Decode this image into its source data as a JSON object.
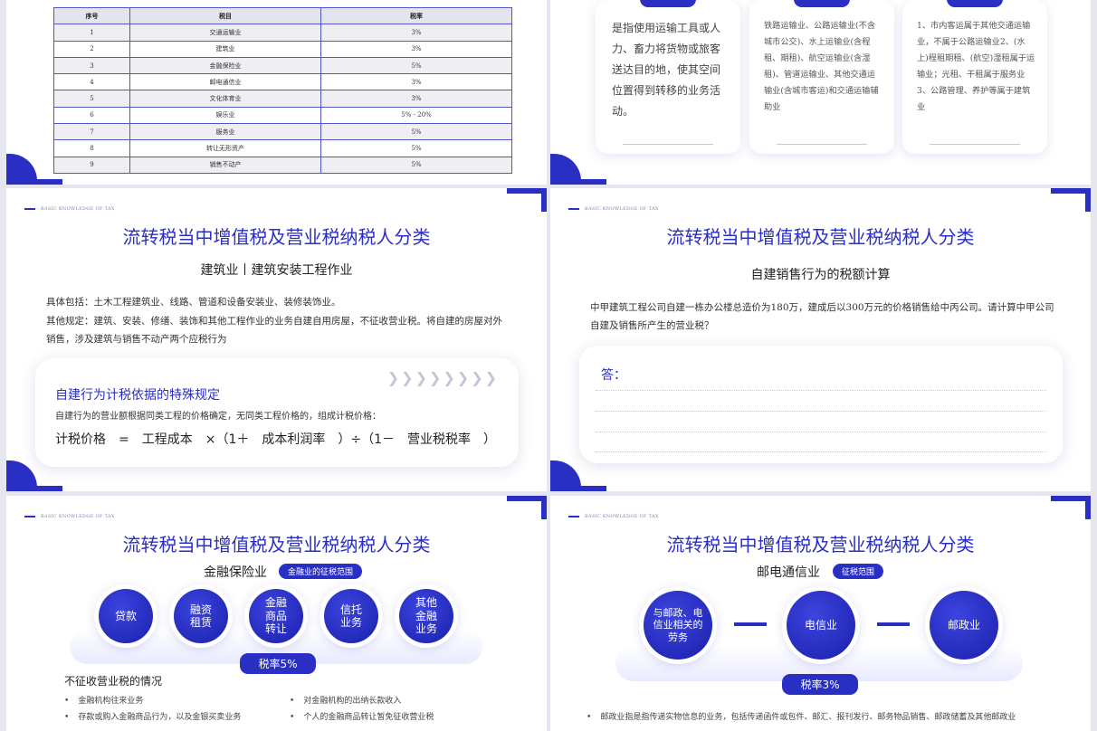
{
  "slide1": {
    "headers": [
      "序号",
      "税目",
      "税率"
    ],
    "rows": [
      [
        "1",
        "交通运输业",
        "3%"
      ],
      [
        "2",
        "建筑业",
        "3%"
      ],
      [
        "3",
        "金融保险业",
        "5%"
      ],
      [
        "4",
        "邮电通信业",
        "3%"
      ],
      [
        "5",
        "文化体育业",
        "3%"
      ],
      [
        "6",
        "娱乐业",
        "5% - 20%"
      ],
      [
        "7",
        "服务业",
        "5%"
      ],
      [
        "8",
        "转让无形资产",
        "5%"
      ],
      [
        "9",
        "销售不动产",
        "5%"
      ]
    ]
  },
  "slide2": {
    "card1": "是指使用运输工具或人力、畜力将货物或旅客送达目的地，使其空间位置得到转移的业务活动。",
    "card2": "铁路运输业、公路运输业(不含城市公交)、水上运输业(含程租、期租)、航空运输业(含湿租)、管道运输业、其他交通运输业(含城市客运)和交通运输辅助业",
    "card3": "1、市内客运属于其他交通运输业，不属于公路运输业2、(水上)程租期租、(航空)湿租属于运输业；光租、干租属于服务业\n3、公路管理、养护等属于建筑业"
  },
  "slide3": {
    "header": "BASIC KNOWLEDGE OF TAX",
    "title": "流转税当中增值税及营业税纳税人分类",
    "subtitle": "建筑业丨建筑安装工程作业",
    "p1": "具体包括：土木工程建筑业、线路、管道和设备安装业、装修装饰业。",
    "p2": "其他规定：建筑、安装、修缮、装饰和其他工程作业的业务自建自用房屋，不征收营业税。将自建的房屋对外销售，涉及建筑与销售不动产两个应税行为",
    "box_title": "自建行为计税依据的特殊规定",
    "box_text": "自建行为的营业额根据同类工程的价格确定，无同类工程价格的，组成计税价格：",
    "formula": "计税价格　=　工程成本　×（1＋　成本利润率　）÷（1－　营业税税率　）"
  },
  "slide4": {
    "header": "BASIC KNOWLEDGE OF TAX",
    "title": "流转税当中增值税及营业税纳税人分类",
    "subtitle": "自建销售行为的税额计算",
    "question": "中甲建筑工程公司自建一栋办公楼总造价为180万，建成后以300万元的价格销售给中丙公司。请计算中甲公司自建及销售所产生的营业税？",
    "answer_label": "答："
  },
  "slide5": {
    "header": "BASIC KNOWLEDGE OF TAX",
    "title": "流转税当中增值税及营业税纳税人分类",
    "subtitle": "金融保险业",
    "tag": "金融业的征税范围",
    "circles": [
      "贷款",
      "融资租赁",
      "金融商品转让",
      "信托业务",
      "其他金融业务"
    ],
    "rate": "税率5%",
    "no_tax_title": "不征收营业税的情况",
    "bullets_left": [
      "金融机构往来业务",
      "存款或购入金融商品行为，以及金银买卖业务"
    ],
    "bullets_right": [
      "对金融机构的出纳长款收入",
      "个人的金融商品转让暂免征收营业税"
    ]
  },
  "slide6": {
    "header": "BASIC KNOWLEDGE OF TAX",
    "title": "流转税当中增值税及营业税纳税人分类",
    "subtitle": "邮电通信业",
    "tag": "征税范围",
    "circles": [
      "与邮政、电信业相关的劳务",
      "电信业",
      "邮政业"
    ],
    "rate": "税率3%",
    "bullet": "邮政业指是指传递实物信息的业务，包括传递函件或包件、邮汇、报刊发行、邮务物品销售、邮政储蓄及其他邮政业"
  }
}
